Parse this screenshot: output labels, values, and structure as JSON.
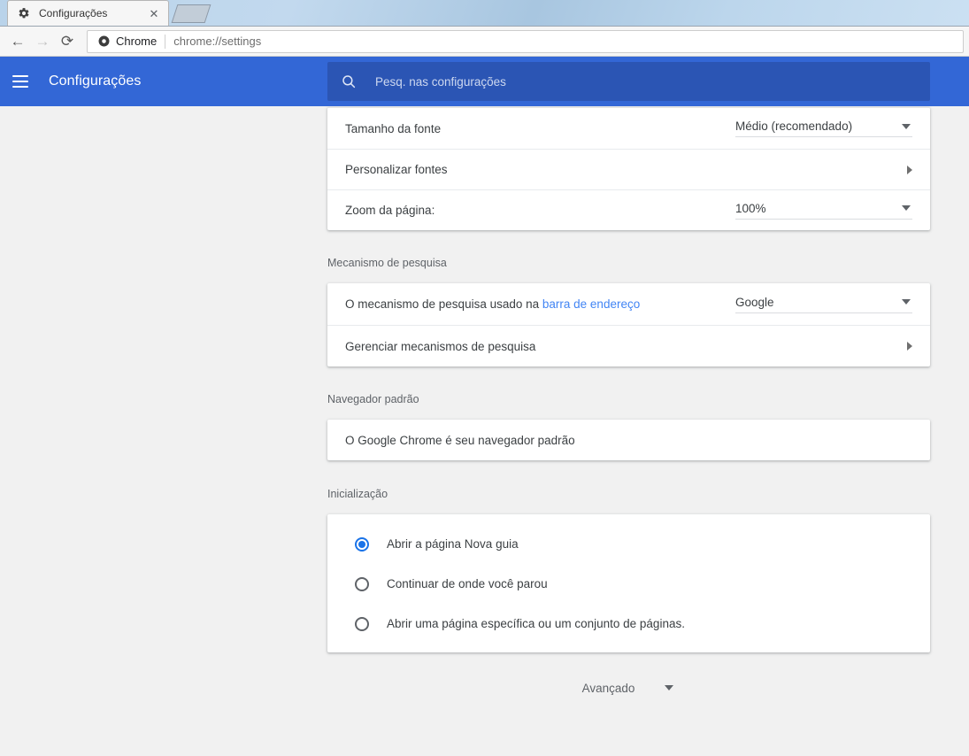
{
  "browser": {
    "tab": {
      "favicon": "gear-icon",
      "title": "Configurações",
      "close": "✕"
    },
    "toolbar": {
      "back": "←",
      "forward": "→",
      "reload": "⟳",
      "omnibox": {
        "secure_icon": "chrome-logo-icon",
        "scheme_label": "Chrome",
        "url": "chrome://settings"
      }
    }
  },
  "settings": {
    "header": {
      "menu_icon": "hamburger-menu-icon",
      "title": "Configurações",
      "search": {
        "icon": "search-icon",
        "placeholder": "Pesq. nas configurações",
        "value": ""
      }
    },
    "appearance_card": {
      "rows": [
        {
          "label": "Tamanho da fonte",
          "control": "select",
          "value": "Médio (recomendado)"
        },
        {
          "label": "Personalizar fontes",
          "control": "arrow",
          "value": ""
        },
        {
          "label": "Zoom da página:",
          "control": "select",
          "value": "100%"
        }
      ]
    },
    "search_engine": {
      "section_title": "Mecanismo de pesquisa",
      "rows": [
        {
          "label_prefix": "O mecanismo de pesquisa usado na ",
          "label_link": "barra de endereço",
          "control": "select",
          "value": "Google"
        },
        {
          "label": "Gerenciar mecanismos de pesquisa",
          "control": "arrow",
          "value": ""
        }
      ]
    },
    "default_browser": {
      "section_title": "Navegador padrão",
      "status_text": "O Google Chrome é seu navegador padrão"
    },
    "startup": {
      "section_title": "Inicialização",
      "options": [
        {
          "label": "Abrir a página Nova guia",
          "selected": true
        },
        {
          "label": "Continuar de onde você parou",
          "selected": false
        },
        {
          "label": "Abrir uma página específica ou um conjunto de páginas.",
          "selected": false
        }
      ]
    },
    "advanced": {
      "label": "Avançado",
      "caret": "chevron-down-icon"
    }
  },
  "colors": {
    "header_blue": "#3367d6",
    "search_blue": "#2b55b4",
    "accent_blue": "#1a73e8",
    "link_blue": "#4285f4",
    "page_bg": "#f1f1f1"
  }
}
